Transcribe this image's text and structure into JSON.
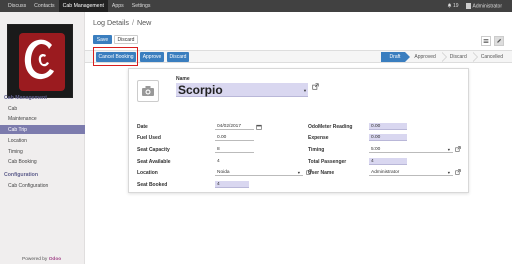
{
  "topbar": {
    "menu": [
      "Discuss",
      "Contacts",
      "Cab Management",
      "Apps",
      "Settings"
    ],
    "active_index": 2,
    "notif_count": "19",
    "user": "Administrator"
  },
  "sidebar": {
    "sections": [
      {
        "title": "Cab Management",
        "items": [
          "Cab",
          "Maintenance",
          "Cab Trip",
          "Location",
          "Timing",
          "Cab Booking"
        ]
      },
      {
        "title": "Configuration",
        "items": [
          "Cab Configuration"
        ]
      }
    ],
    "active_item": "Cab Trip",
    "powered_prefix": "Powered by",
    "powered_brand": "Odoo"
  },
  "header": {
    "breadcrumb_parent": "Log Details",
    "breadcrumb_sep": "/",
    "breadcrumb_current": "New",
    "save_label": "Save",
    "discard_label": "Discard"
  },
  "statusbar": {
    "cancel_booking_label": "Cancel Booking",
    "approve_label": "Approve",
    "discard_label": "Discard",
    "stages": [
      "Draft",
      "Approved",
      "Discard",
      "Cancelled"
    ],
    "current_stage": "Draft"
  },
  "form": {
    "name_label": "Name",
    "name_value": "Scorpio",
    "left": {
      "date_label": "Date",
      "date_value": "04/02/2017",
      "fuel_label": "Fuel Used",
      "fuel_value": "0.00",
      "capacity_label": "Seat Capacity",
      "capacity_value": "8",
      "available_label": "Seat Available",
      "available_value": "4",
      "location_label": "Location",
      "location_value": "Noida",
      "booked_label": "Seat Booked",
      "booked_value": "4"
    },
    "right": {
      "odometer_label": "OdoMeter Reading",
      "odometer_value": "0.00",
      "expense_label": "Expense",
      "expense_value": "0.00",
      "timing_label": "Timing",
      "timing_value": "5:00",
      "passenger_label": "Total Passenger",
      "passenger_value": "4",
      "user_label": "User Name",
      "user_value": "Administrator"
    }
  },
  "colors": {
    "accent": "#3a7ebf",
    "sidebar_active": "#7c7bad",
    "required_field": "#d9d7f0",
    "highlight_box": "#d81e1e",
    "logo_red": "#9b1b1f"
  },
  "icons": [
    "bell-icon",
    "calendar-icon",
    "external-link-icon",
    "camera-icon",
    "list-view-icon",
    "edit-view-icon",
    "caret-down-icon"
  ]
}
